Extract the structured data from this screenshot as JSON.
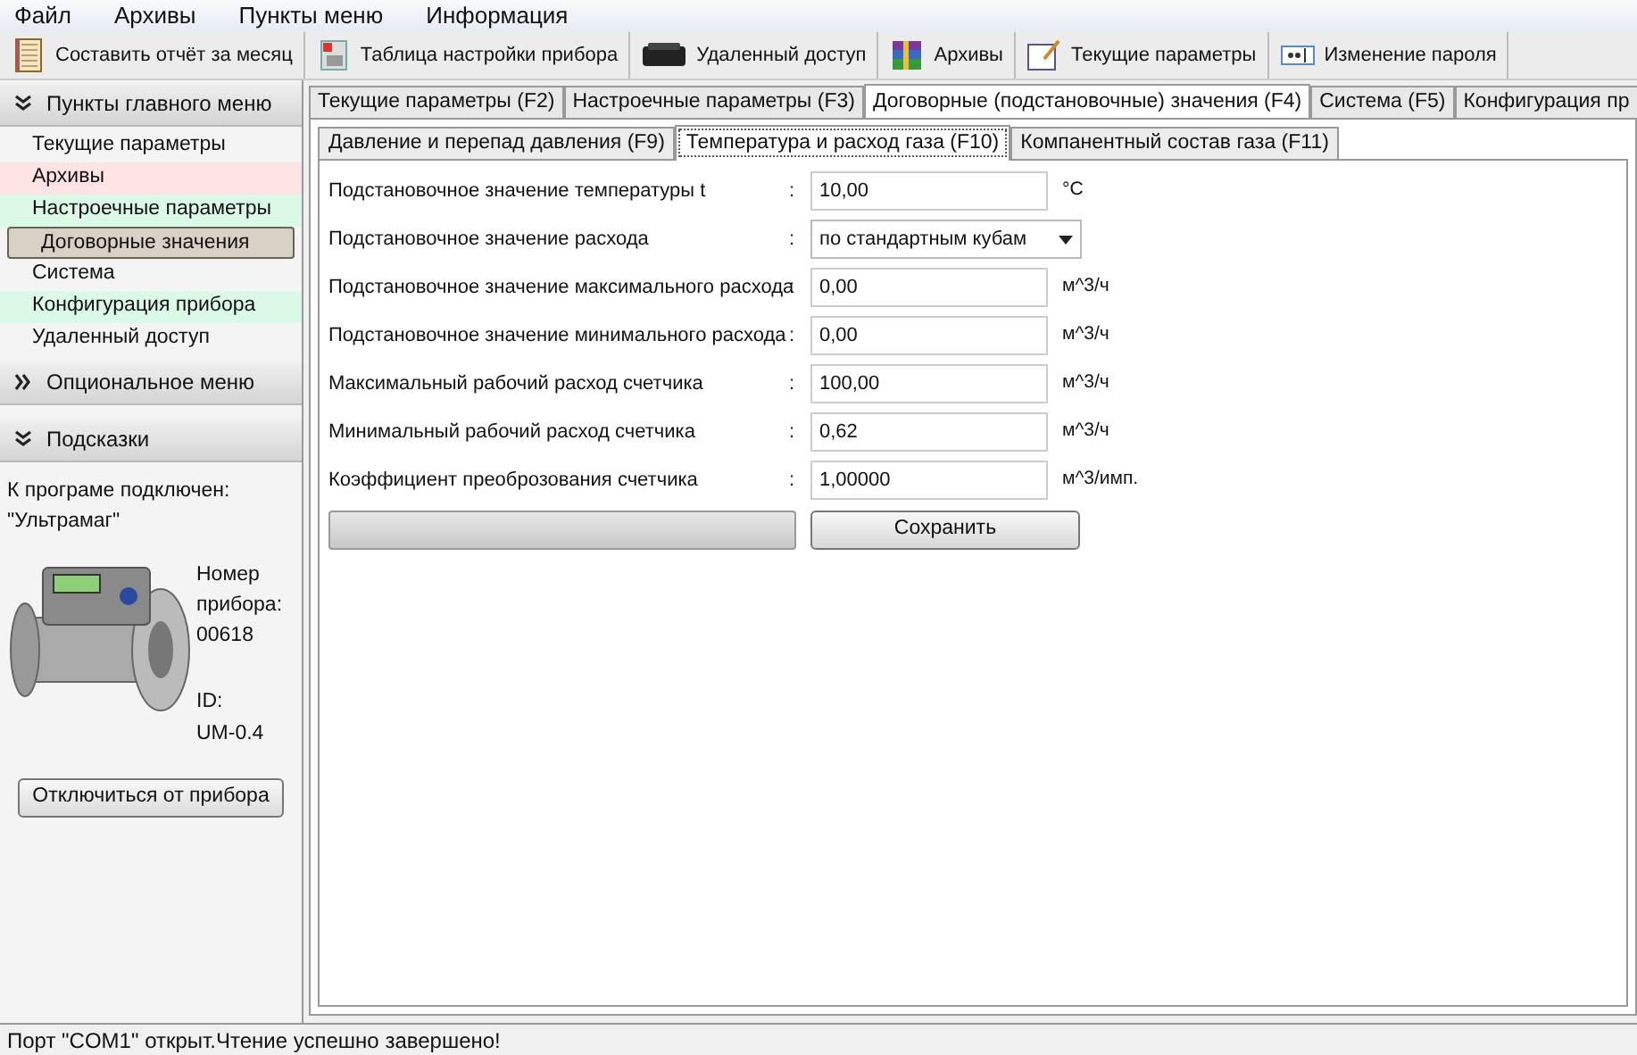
{
  "menu_bar": [
    "Файл",
    "Архивы",
    "Пункты меню",
    "Информация"
  ],
  "toolbar": [
    {
      "label": "Составить отчёт за месяц",
      "kind": "notebook"
    },
    {
      "label": "Таблица настройки прибора",
      "kind": "sheet"
    },
    {
      "label": "Удаленный доступ",
      "kind": "device"
    },
    {
      "label": "Архивы",
      "kind": "books"
    },
    {
      "label": "Текущие параметры",
      "kind": "pencil"
    },
    {
      "label": "Изменение пароля",
      "kind": "password"
    }
  ],
  "sidebar": {
    "main_menu": {
      "title": "Пункты главного меню",
      "expanded": true,
      "items": [
        {
          "label": "Текущие параметры",
          "selected": false,
          "color": "#f4f4f4"
        },
        {
          "label": "Архивы",
          "selected": false,
          "color": "#fde4e4"
        },
        {
          "label": "Настроечные параметры",
          "selected": false,
          "color": "#dcf8e6"
        },
        {
          "label": "Договорные значения",
          "selected": true,
          "color": "#d8d2c6"
        },
        {
          "label": "Система",
          "selected": false,
          "color": "#f4f4f4"
        },
        {
          "label": "Конфигурация прибора",
          "selected": false,
          "color": "#dcf8e6"
        },
        {
          "label": "Удаленный доступ",
          "selected": false,
          "color": "#f4f4f4"
        }
      ]
    },
    "optional_menu": {
      "title": "Опциональное меню",
      "expanded": false
    },
    "hints": {
      "title": "Подсказки",
      "expanded": true,
      "connected_label": "К програме подключен:",
      "device_name": "\"Ультрамаг\"",
      "number_label": "Номер прибора:",
      "number": "00618",
      "id_label": "ID:",
      "id": "UM-0.4",
      "disconnect_button": "Отключиться от прибора"
    }
  },
  "tabs": [
    {
      "label": "Текущие параметры (F2)",
      "selected": false
    },
    {
      "label": "Настроечные параметры (F3)",
      "selected": false
    },
    {
      "label": "Договорные (подстановочные) значения (F4)",
      "selected": true
    },
    {
      "label": "Система (F5)",
      "selected": false
    },
    {
      "label": "Конфигурация пр",
      "selected": false
    }
  ],
  "subtabs": [
    {
      "label": "Давление и перепад давления (F9)",
      "selected": false
    },
    {
      "label": "Температура и расход газа (F10)",
      "selected": true
    },
    {
      "label": "Компанентный состав газа (F11)",
      "selected": false
    }
  ],
  "form": [
    {
      "label": "Подстановочное значение температуры t",
      "kind": "input",
      "value": "10,00",
      "unit": "°C"
    },
    {
      "label": "Подстановочное значение расхода",
      "kind": "select",
      "value": "по стандартным кубам"
    },
    {
      "label": "Подстановочное значение максимального расхода",
      "kind": "input",
      "value": "0,00",
      "unit": "м^3/ч"
    },
    {
      "label": "Подстановочное значение минимального расхода",
      "kind": "input",
      "value": "0,00",
      "unit": "м^3/ч"
    },
    {
      "label": "Максимальный рабочий расход счетчика",
      "kind": "input",
      "value": "100,00",
      "unit": "м^3/ч"
    },
    {
      "label": "Минимальный рабочий расход счетчика",
      "kind": "input",
      "value": "0,62",
      "unit": "м^3/ч"
    },
    {
      "label": "Коэффициент преоброзования счетчика",
      "kind": "input",
      "value": "1,00000",
      "unit": "м^3/имп."
    }
  ],
  "colon": ":",
  "progress": {
    "level": 0
  },
  "save_button": "Сохранить",
  "status_bar": "Порт \"COM1\" открыт.Чтение успешно завершено!"
}
